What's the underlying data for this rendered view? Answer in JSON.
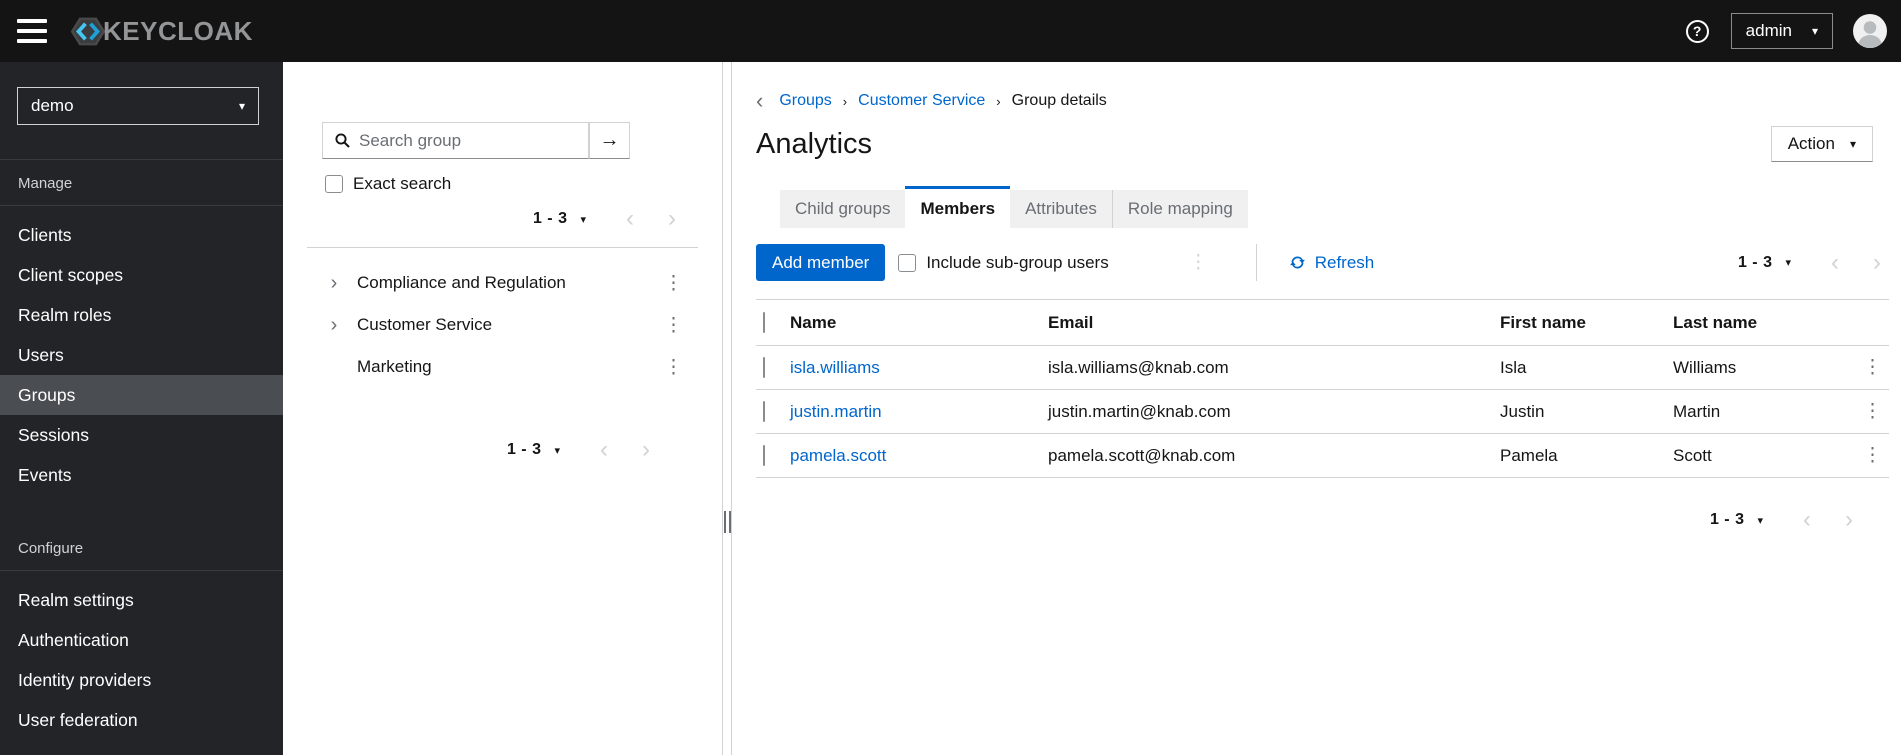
{
  "icons": {
    "caret_down": "▾",
    "angle_left": "‹",
    "angle_right": "›",
    "breadcrumb_sep": "›",
    "kebab": "⋮",
    "arrow_right": "→",
    "help": "?"
  },
  "masthead": {
    "brand": "KEYCLOAK",
    "user": "admin"
  },
  "sidebar": {
    "realm": "demo",
    "manage": {
      "title": "Manage",
      "items": [
        "Clients",
        "Client scopes",
        "Realm roles",
        "Users",
        "Groups",
        "Sessions",
        "Events"
      ],
      "active_item": "Groups"
    },
    "configure": {
      "title": "Configure",
      "items": [
        "Realm settings",
        "Authentication",
        "Identity providers",
        "User federation"
      ]
    }
  },
  "tree_panel": {
    "search_placeholder": "Search group",
    "exact_search_label": "Exact search",
    "pagination_range": "1 - 3",
    "groups": [
      {
        "name": "Compliance and Regulation",
        "expandable": true
      },
      {
        "name": "Customer Service",
        "expandable": true
      },
      {
        "name": "Marketing",
        "expandable": false
      }
    ]
  },
  "main": {
    "breadcrumb": {
      "items": [
        "Groups",
        "Customer Service",
        "Group details"
      ]
    },
    "title": "Analytics",
    "action_label": "Action",
    "tabs": [
      {
        "label": "Child groups",
        "active": false
      },
      {
        "label": "Members",
        "active": true
      },
      {
        "label": "Attributes",
        "active": false
      },
      {
        "label": "Role mapping",
        "active": false
      }
    ],
    "toolbar": {
      "add_member_label": "Add member",
      "include_subgroups_label": "Include sub-group users",
      "refresh_label": "Refresh"
    },
    "pagination_range": "1 - 3",
    "table": {
      "columns": [
        "Name",
        "Email",
        "First name",
        "Last name"
      ],
      "rows": [
        {
          "username": "isla.williams",
          "email": "isla.williams@knab.com",
          "first_name": "Isla",
          "last_name": "Williams"
        },
        {
          "username": "justin.martin",
          "email": "justin.martin@knab.com",
          "first_name": "Justin",
          "last_name": "Martin"
        },
        {
          "username": "pamela.scott",
          "email": "pamela.scott@knab.com",
          "first_name": "Pamela",
          "last_name": "Scott"
        }
      ]
    }
  },
  "colors": {
    "primary": "#0066cc",
    "link": "#0066cc",
    "masthead_bg": "#141414",
    "sidebar_bg": "#222427",
    "sidebar_active_bg": "#4a4e52",
    "tab_inactive_bg": "#f0f0f0",
    "border": "#d2d2d2"
  }
}
